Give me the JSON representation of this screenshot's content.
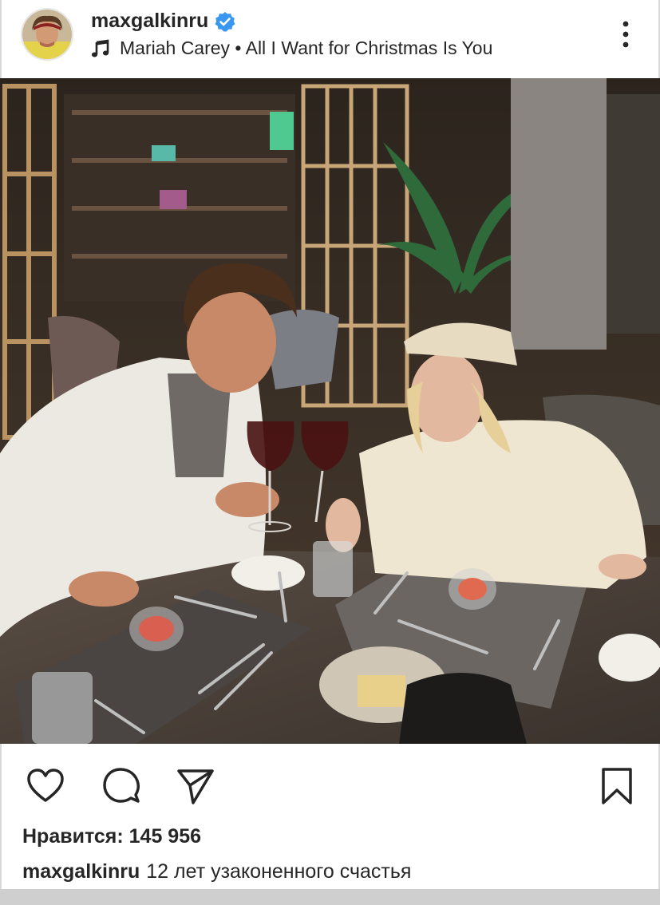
{
  "post": {
    "username": "maxgalkinru",
    "music": "Mariah Carey • All I Want for Christmas Is You",
    "likes_label": "Нравится: 145 956",
    "caption_user": "maxgalkinru",
    "caption_text": "12 лет узаконенного счастья"
  },
  "icons": {
    "verified": "verified-badge-icon",
    "music": "music-note-icon",
    "more": "more-options-icon",
    "like": "heart-icon",
    "comment": "comment-icon",
    "share": "send-icon",
    "save": "bookmark-icon",
    "mute": "muted-speaker-icon"
  },
  "colors": {
    "verified": "#3897f0",
    "text": "#262626"
  }
}
